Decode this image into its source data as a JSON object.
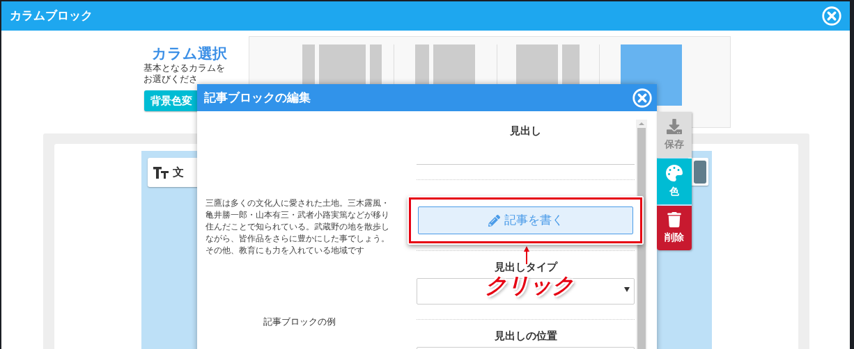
{
  "window": {
    "title": "カラムブロック"
  },
  "column_select": {
    "title": "カラム選択",
    "description": [
      "基本となるカラムを",
      "お選びくださ"
    ],
    "background_button": "背景色変",
    "options": [
      {
        "kind": "narrow-wide-narrow",
        "selected": false
      },
      {
        "kind": "narrow-wide",
        "selected": false
      },
      {
        "kind": "wide-narrow",
        "selected": false
      },
      {
        "kind": "single",
        "selected": true
      }
    ]
  },
  "canvas": {
    "text_card": {
      "label": "文"
    }
  },
  "modal": {
    "title": "記事ブロックの編集",
    "example_text": "三鷹は多くの文化人に愛された土地。三木露風・亀井勝一郎・山本有三・武者小路実篤などが移り住んだことで知られている。武蔵野の地を散歩しながら、皆作品をさらに豊かにした事でしょう。その他、教育にも力を入れている地域です",
    "example_caption": "記事ブロックの例",
    "fields": [
      {
        "kind": "input",
        "label": "見出し"
      },
      {
        "kind": "button",
        "button": "記事を書く",
        "highlighted": true
      },
      {
        "kind": "select",
        "label": "見出しタイプ",
        "arrow": true
      },
      {
        "kind": "select",
        "label": "見出しの位置"
      }
    ]
  },
  "toolbar": [
    {
      "kind": "save",
      "label": "保存"
    },
    {
      "kind": "color",
      "label": "色"
    },
    {
      "kind": "delete",
      "label": "削除"
    }
  ],
  "annotation": {
    "text": "クリック"
  }
}
